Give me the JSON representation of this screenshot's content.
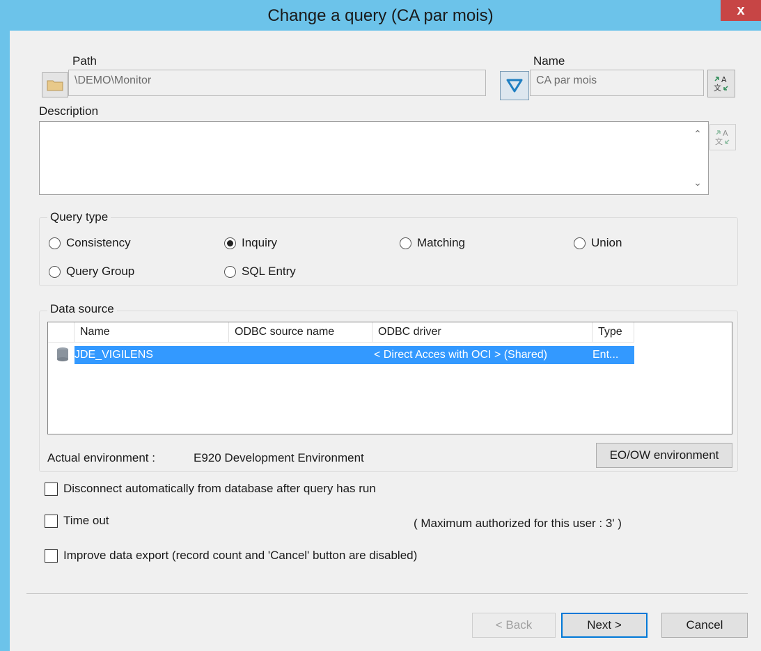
{
  "window": {
    "title": "Change a query (CA par mois)",
    "close_label": "x"
  },
  "path": {
    "label": "Path",
    "value": "\\DEMO\\Monitor"
  },
  "name": {
    "label": "Name",
    "value": "CA par mois"
  },
  "description": {
    "label": "Description",
    "value": ""
  },
  "query_type": {
    "label": "Query type",
    "options": [
      {
        "label": "Consistency",
        "selected": false
      },
      {
        "label": "Inquiry",
        "selected": true
      },
      {
        "label": "Matching",
        "selected": false
      },
      {
        "label": "Union",
        "selected": false
      },
      {
        "label": "Query Group",
        "selected": false
      },
      {
        "label": "SQL Entry",
        "selected": false
      }
    ]
  },
  "data_source": {
    "label": "Data source",
    "columns": [
      "Name",
      "ODBC source name",
      "ODBC driver",
      "Type"
    ],
    "rows": [
      {
        "name": "JDE_VIGILENS",
        "odbc_source_name": "",
        "odbc_driver": "< Direct Acces with OCI > (Shared)",
        "type": "Ent..."
      }
    ],
    "env_label": "Actual environment :",
    "env_value": "E920 Development Environment",
    "env_button": "EO/OW environment"
  },
  "options": {
    "disconnect": "Disconnect automatically from database after query has run",
    "timeout": "Time out",
    "timeout_note": "( Maximum authorized for this user :   3' )",
    "improve_export": "Improve data export (record count and 'Cancel' button are disabled)"
  },
  "buttons": {
    "back": "< Back",
    "next": "Next >",
    "cancel": "Cancel"
  },
  "colors": {
    "titlebar": "#6cc3ea",
    "selection": "#3399ff",
    "close": "#c74545"
  }
}
